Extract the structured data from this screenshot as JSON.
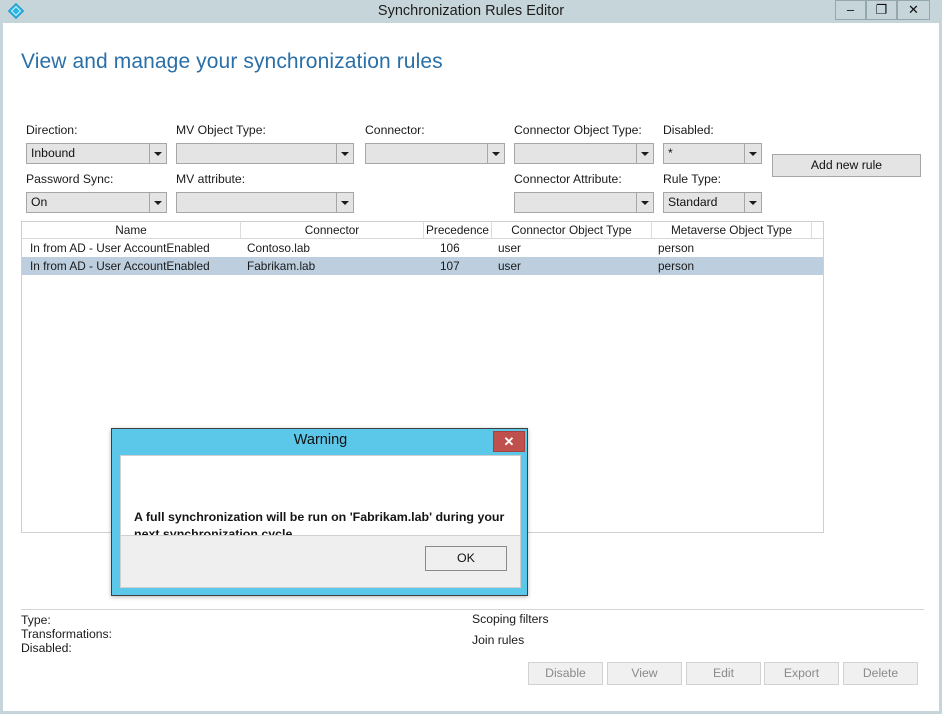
{
  "window": {
    "title": "Synchronization Rules Editor",
    "icon": "sync-diamond-icon",
    "controls": {
      "minimize": "–",
      "maximize": "❐",
      "close": "✕"
    }
  },
  "page": {
    "heading": "View and manage your synchronization rules",
    "heading_color": "#2a6fa8"
  },
  "filters": {
    "direction": {
      "label": "Direction:",
      "value": "Inbound"
    },
    "mv_object_type": {
      "label": "MV Object Type:",
      "value": ""
    },
    "connector": {
      "label": "Connector:",
      "value": ""
    },
    "connector_object_type": {
      "label": "Connector Object Type:",
      "value": ""
    },
    "disabled": {
      "label": "Disabled:",
      "value": "*"
    },
    "password_sync": {
      "label": "Password Sync:",
      "value": "On"
    },
    "mv_attribute": {
      "label": "MV attribute:",
      "value": ""
    },
    "connector_attribute": {
      "label": "Connector Attribute:",
      "value": ""
    },
    "rule_type": {
      "label": "Rule Type:",
      "value": "Standard"
    }
  },
  "toolbar": {
    "add_new_rule": "Add new rule"
  },
  "rules_table": {
    "columns": [
      "Name",
      "Connector",
      "Precedence",
      "Connector Object Type",
      "Metaverse Object Type"
    ],
    "rows": [
      {
        "name": "In from AD - User AccountEnabled",
        "connector": "Contoso.lab",
        "precedence": "106",
        "connector_object_type": "user",
        "metaverse_object_type": "person",
        "selected": false
      },
      {
        "name": "In from AD - User AccountEnabled",
        "connector": "Fabrikam.lab",
        "precedence": "107",
        "connector_object_type": "user",
        "metaverse_object_type": "person",
        "selected": true
      }
    ]
  },
  "details": {
    "type_label": "Type:",
    "type_value": "",
    "transformations_label": "Transformations:",
    "disabled_label": "Disabled:",
    "scoping_filters_label": "Scoping filters",
    "join_rules_label": "Join rules"
  },
  "actions": {
    "disable": "Disable",
    "view": "View",
    "edit": "Edit",
    "export": "Export",
    "delete": "Delete"
  },
  "dialog": {
    "title": "Warning",
    "close_glyph": "✕",
    "message": "A full synchronization will be run on 'Fabrikam.lab' during your next synchronization cycle.",
    "ok_label": "OK",
    "titlebar_color": "#5bc8ea",
    "close_color": "#c0504d"
  }
}
